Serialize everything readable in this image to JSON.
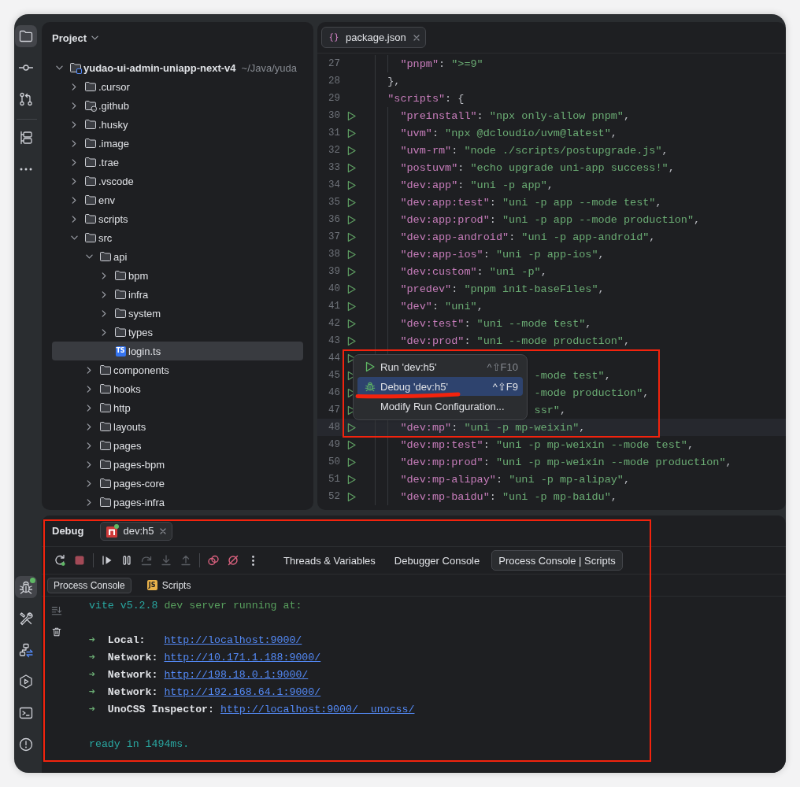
{
  "tool_strip": {
    "top": [
      {
        "selected": true
      },
      {
        "selected": false
      },
      {
        "selected": false
      },
      {
        "selected": false
      },
      {
        "selected": false
      }
    ],
    "bottom": [
      {
        "selected": true,
        "status_dot": true
      },
      {
        "selected": false,
        "status_dot": false
      },
      {
        "selected": false,
        "status_dot": false
      },
      {
        "selected": false,
        "status_dot": false
      },
      {
        "selected": false,
        "status_dot": false
      },
      {
        "selected": false,
        "status_dot": false
      }
    ]
  },
  "project": {
    "title": "Project",
    "tree": [
      {
        "label": "yudao-ui-admin-uniapp-next-v4",
        "path": "~/Java/yuda",
        "kind": "module",
        "expanded": true,
        "selected": false,
        "children": [
          {
            "label": ".cursor",
            "kind": "folder",
            "expanded": false,
            "selected": false
          },
          {
            "label": ".github",
            "kind": "github-folder",
            "expanded": false,
            "selected": false
          },
          {
            "label": ".husky",
            "kind": "folder",
            "expanded": false,
            "selected": false
          },
          {
            "label": ".image",
            "kind": "folder",
            "expanded": false,
            "selected": false
          },
          {
            "label": ".trae",
            "kind": "folder",
            "expanded": false,
            "selected": false
          },
          {
            "label": ".vscode",
            "kind": "folder",
            "expanded": false,
            "selected": false
          },
          {
            "label": "env",
            "kind": "folder",
            "expanded": false,
            "selected": false
          },
          {
            "label": "scripts",
            "kind": "folder",
            "expanded": false,
            "selected": false
          },
          {
            "label": "src",
            "kind": "folder",
            "expanded": true,
            "selected": false,
            "children": [
              {
                "label": "api",
                "kind": "folder",
                "expanded": true,
                "selected": false,
                "children": [
                  {
                    "label": "bpm",
                    "kind": "folder",
                    "expanded": false,
                    "selected": false
                  },
                  {
                    "label": "infra",
                    "kind": "folder",
                    "expanded": false,
                    "selected": false
                  },
                  {
                    "label": "system",
                    "kind": "folder",
                    "expanded": false,
                    "selected": false
                  },
                  {
                    "label": "types",
                    "kind": "folder",
                    "expanded": false,
                    "selected": false
                  },
                  {
                    "label": "login.ts",
                    "kind": "file",
                    "badge": "TS",
                    "selected": true
                  }
                ]
              },
              {
                "label": "components",
                "kind": "folder",
                "expanded": false,
                "selected": false
              },
              {
                "label": "hooks",
                "kind": "folder",
                "expanded": false,
                "selected": false
              },
              {
                "label": "http",
                "kind": "folder",
                "expanded": false,
                "selected": false
              },
              {
                "label": "layouts",
                "kind": "folder",
                "expanded": false,
                "selected": false
              },
              {
                "label": "pages",
                "kind": "folder",
                "expanded": false,
                "selected": false
              },
              {
                "label": "pages-bpm",
                "kind": "folder",
                "expanded": false,
                "selected": false
              },
              {
                "label": "pages-core",
                "kind": "folder",
                "expanded": false,
                "selected": false
              },
              {
                "label": "pages-infra",
                "kind": "folder",
                "expanded": false,
                "selected": false
              }
            ]
          }
        ]
      }
    ]
  },
  "editor": {
    "tabs": [
      {
        "label": "package.json",
        "selected": true
      }
    ],
    "lines": [
      {
        "number": "27",
        "kind": "member",
        "runnable": false,
        "current": false,
        "key": "\"pnpm\"",
        "sep": ": ",
        "value": "\">=9\""
      },
      {
        "number": "28",
        "kind": "block",
        "runnable": false,
        "current": false,
        "end": "},"
      },
      {
        "number": "29",
        "kind": "block",
        "runnable": false,
        "current": false,
        "key": "\"scripts\"",
        "sep": ": ",
        "end": "{"
      },
      {
        "number": "30",
        "kind": "member",
        "runnable": true,
        "current": false,
        "key": "\"preinstall\"",
        "sep": ": ",
        "value": "\"npx only-allow pnpm\"",
        "end": ","
      },
      {
        "number": "31",
        "kind": "member",
        "runnable": true,
        "current": false,
        "key": "\"uvm\"",
        "sep": ": ",
        "value": "\"npx @dcloudio/uvm@latest\"",
        "end": ","
      },
      {
        "number": "32",
        "kind": "member",
        "runnable": true,
        "current": false,
        "key": "\"uvm-rm\"",
        "sep": ": ",
        "value": "\"node ./scripts/postupgrade.js\"",
        "end": ","
      },
      {
        "number": "33",
        "kind": "member",
        "runnable": true,
        "current": false,
        "key": "\"postuvm\"",
        "sep": ": ",
        "value": "\"echo upgrade uni-app success!\"",
        "end": ","
      },
      {
        "number": "34",
        "kind": "member",
        "runnable": true,
        "current": false,
        "key": "\"dev:app\"",
        "sep": ": ",
        "value": "\"uni -p app\"",
        "end": ","
      },
      {
        "number": "35",
        "kind": "member",
        "runnable": true,
        "current": false,
        "key": "\"dev:app:test\"",
        "sep": ": ",
        "value": "\"uni -p app --mode test\"",
        "end": ","
      },
      {
        "number": "36",
        "kind": "member",
        "runnable": true,
        "current": false,
        "key": "\"dev:app:prod\"",
        "sep": ": ",
        "value": "\"uni -p app --mode production\"",
        "end": ","
      },
      {
        "number": "37",
        "kind": "member",
        "runnable": true,
        "current": false,
        "key": "\"dev:app-android\"",
        "sep": ": ",
        "value": "\"uni -p app-android\"",
        "end": ","
      },
      {
        "number": "38",
        "kind": "member",
        "runnable": true,
        "current": false,
        "key": "\"dev:app-ios\"",
        "sep": ": ",
        "value": "\"uni -p app-ios\"",
        "end": ","
      },
      {
        "number": "39",
        "kind": "member",
        "runnable": true,
        "current": false,
        "key": "\"dev:custom\"",
        "sep": ": ",
        "value": "\"uni -p\"",
        "end": ","
      },
      {
        "number": "40",
        "kind": "member",
        "runnable": true,
        "current": false,
        "key": "\"predev\"",
        "sep": ": ",
        "value": "\"pnpm init-baseFiles\"",
        "end": ","
      },
      {
        "number": "41",
        "kind": "member",
        "runnable": true,
        "current": false,
        "key": "\"dev\"",
        "sep": ": ",
        "value": "\"uni\"",
        "end": ","
      },
      {
        "number": "42",
        "kind": "member",
        "runnable": true,
        "current": false,
        "key": "\"dev:test\"",
        "sep": ": ",
        "value": "\"uni --mode test\"",
        "end": ","
      },
      {
        "number": "43",
        "kind": "member",
        "runnable": true,
        "current": false,
        "key": "\"dev:prod\"",
        "sep": ": ",
        "value": "\"uni --mode production\"",
        "end": ","
      },
      {
        "number": "44",
        "kind": "member",
        "runnable": true,
        "current": false
      },
      {
        "number": "45",
        "kind": "member",
        "runnable": true,
        "current": false,
        "tail": "-mode test\"",
        "end": ","
      },
      {
        "number": "46",
        "kind": "member",
        "runnable": true,
        "current": false,
        "tail": "-mode production\"",
        "end": ","
      },
      {
        "number": "47",
        "kind": "member",
        "runnable": true,
        "current": false,
        "tail": "ssr\"",
        "end": ","
      },
      {
        "number": "48",
        "kind": "member",
        "runnable": true,
        "current": true,
        "key": "\"dev:mp\"",
        "sep": ": ",
        "value": "\"uni -p mp-weixin\"",
        "end": ","
      },
      {
        "number": "49",
        "kind": "member",
        "runnable": true,
        "current": false,
        "key": "\"dev:mp:test\"",
        "sep": ": ",
        "value": "\"uni -p mp-weixin --mode test\"",
        "end": ","
      },
      {
        "number": "50",
        "kind": "member",
        "runnable": true,
        "current": false,
        "key": "\"dev:mp:prod\"",
        "sep": ": ",
        "value": "\"uni -p mp-weixin --mode production\"",
        "end": ","
      },
      {
        "number": "51",
        "kind": "member",
        "runnable": true,
        "current": false,
        "key": "\"dev:mp-alipay\"",
        "sep": ": ",
        "value": "\"uni -p mp-alipay\"",
        "end": ","
      },
      {
        "number": "52",
        "kind": "member",
        "runnable": true,
        "current": false,
        "key": "\"dev:mp-baidu\"",
        "sep": ": ",
        "value": "\"uni -p mp-baidu\"",
        "end": ","
      }
    ]
  },
  "run_menu": {
    "highlighted": true,
    "items": [
      {
        "kind": "run",
        "label": "Run 'dev:h5'",
        "shortcut": "^⇧F10",
        "selected": false,
        "underlined": false
      },
      {
        "kind": "debug",
        "label": "Debug 'dev:h5'",
        "shortcut": "^⇧F9",
        "selected": true,
        "underlined": true
      },
      {
        "kind": "plain",
        "label": "Modify Run Configuration...",
        "selected": false,
        "underlined": false
      }
    ]
  },
  "debug": {
    "title": "Debug",
    "highlighted": true,
    "session": {
      "label": "dev:h5",
      "selected": true,
      "running": true
    },
    "toolbar": [
      {
        "disabled": false
      },
      {
        "disabled": false
      },
      {
        "disabled": false
      },
      {
        "disabled": false
      },
      {
        "disabled": true
      },
      {
        "disabled": true
      },
      {
        "disabled": true
      },
      {
        "disabled": false
      },
      {
        "disabled": false
      },
      {
        "disabled": false
      }
    ],
    "tabs": [
      {
        "label": "Threads & Variables",
        "selected": false
      },
      {
        "label": "Debugger Console",
        "selected": false
      },
      {
        "label": "Process Console | Scripts",
        "selected": true
      }
    ],
    "subtabs": [
      {
        "label": "Process Console",
        "selected": true
      },
      {
        "label": "Scripts",
        "selected": false,
        "badge": "JS"
      }
    ],
    "console": [
      {
        "kind": "text",
        "parts": [
          {
            "kind": "accent",
            "text": "vite v5.2.8"
          },
          {
            "kind": "info",
            "text": " dev server running at:"
          }
        ]
      },
      {
        "kind": "blank"
      },
      {
        "kind": "link",
        "arrow": "➜",
        "label": "Local:",
        "url": "http://localhost:9000/"
      },
      {
        "kind": "link",
        "arrow": "➜",
        "label": "Network:",
        "url": "http://10.171.1.188:9000/"
      },
      {
        "kind": "link",
        "arrow": "➜",
        "label": "Network:",
        "url": "http://198.18.0.1:9000/"
      },
      {
        "kind": "link",
        "arrow": "➜",
        "label": "Network:",
        "url": "http://192.168.64.1:9000/"
      },
      {
        "kind": "link",
        "arrow": "➜",
        "label": "UnoCSS Inspector:",
        "url": "http://localhost:9000/__unocss/"
      },
      {
        "kind": "blank"
      },
      {
        "kind": "text",
        "parts": [
          {
            "kind": "accent",
            "text": "ready in 1494ms."
          }
        ]
      }
    ]
  }
}
